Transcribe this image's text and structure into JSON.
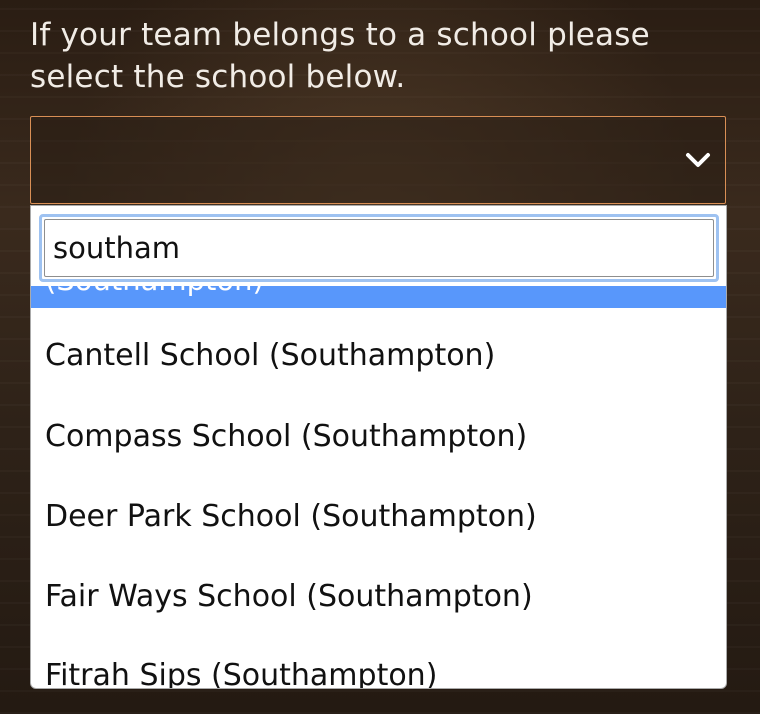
{
  "prompt": {
    "text": "If your team belongs to a school please select the school below."
  },
  "select": {
    "value": "",
    "arrow_icon": "chevron-down-icon",
    "border_color": "#d98f55"
  },
  "search": {
    "value": "southam"
  },
  "results": {
    "highlighted_label": "(Southampton)",
    "highlight_color": "#5897fb",
    "options": [
      {
        "label": "Cantell School (Southampton)"
      },
      {
        "label": "Compass School (Southampton)"
      },
      {
        "label": "Deer Park School (Southampton)"
      },
      {
        "label": "Fair Ways School (Southampton)"
      },
      {
        "label": "Fitrah Sips (Southampton)"
      }
    ]
  }
}
